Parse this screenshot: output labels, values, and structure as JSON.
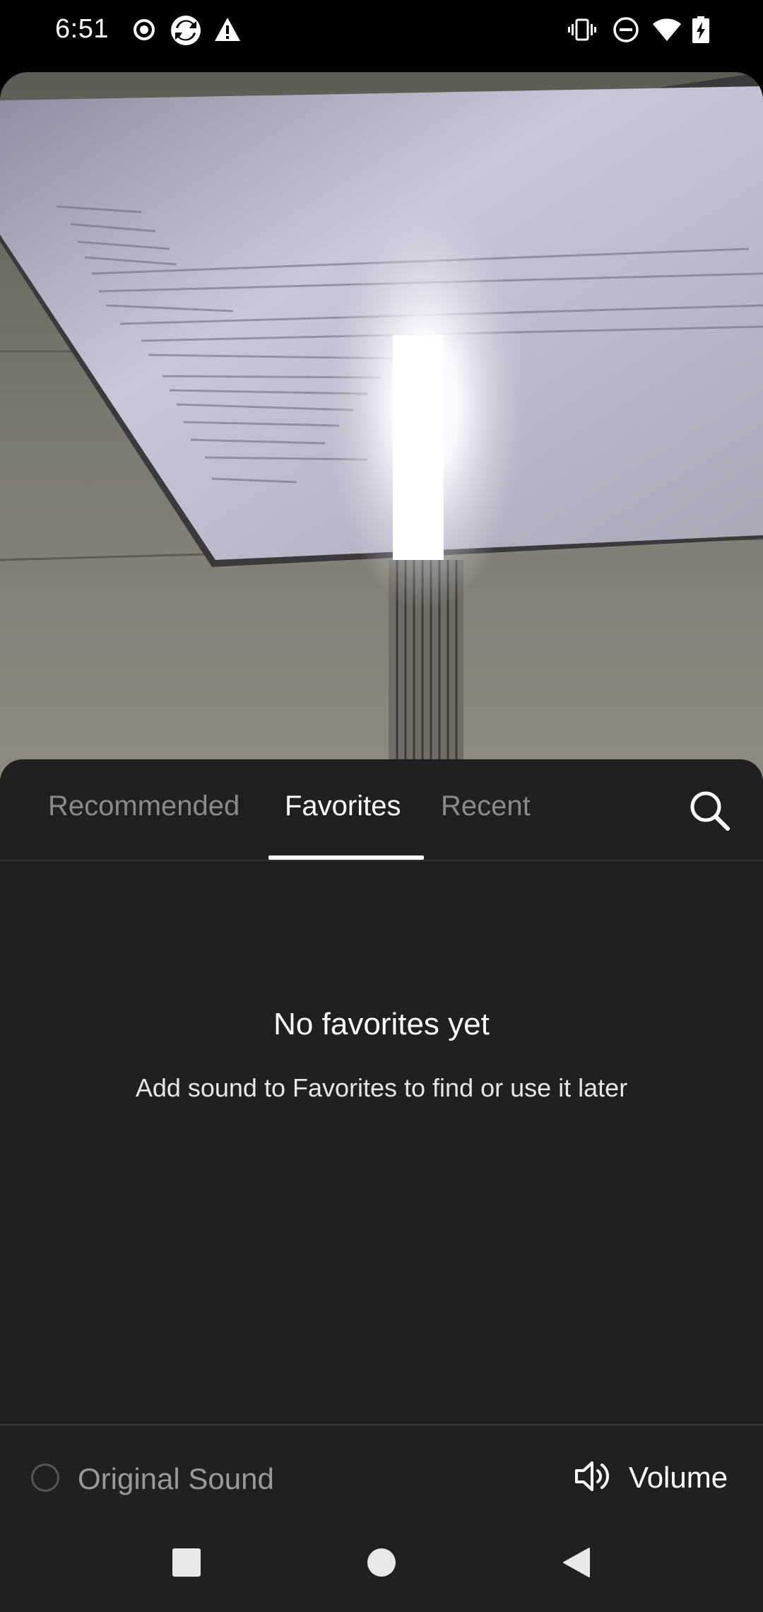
{
  "status_bar": {
    "time": "6:51",
    "left_icons": [
      "record-icon",
      "sync-app-icon",
      "warning-icon"
    ],
    "right_icons": [
      "vibrate-icon",
      "do-not-disturb-icon",
      "wifi-icon",
      "battery-charging-icon"
    ]
  },
  "sound_picker": {
    "tabs": [
      {
        "label": "Recommended",
        "active": false
      },
      {
        "label": "Favorites",
        "active": true
      },
      {
        "label": "Recent",
        "active": false
      }
    ],
    "search_icon": "search-icon",
    "empty_state": {
      "title": "No favorites yet",
      "subtitle": "Add sound to Favorites to find or use it later"
    },
    "original_sound_label": "Original Sound",
    "volume_label": "Volume"
  },
  "nav_bar": {
    "buttons": [
      "recents-square-icon",
      "home-circle-icon",
      "back-triangle-icon"
    ]
  },
  "colors": {
    "sheet_bg": "#202020",
    "active_tab": "#ffffff",
    "inactive_tab": "#8a8a8a"
  }
}
